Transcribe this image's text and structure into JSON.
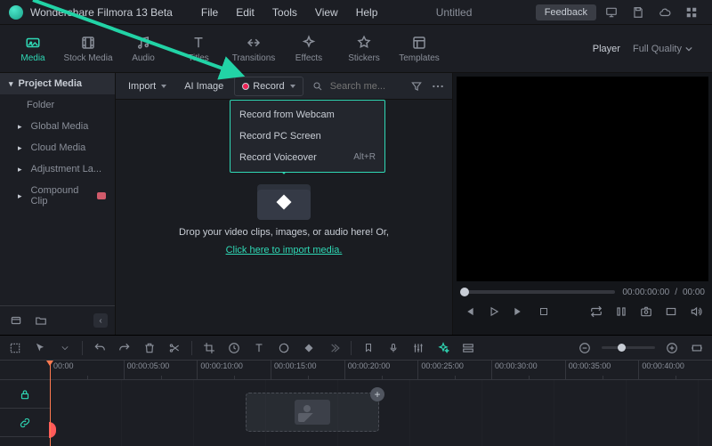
{
  "app": {
    "title": "Wondershare Filmora 13 Beta",
    "project": "Untitled",
    "feedback": "Feedback"
  },
  "menu": [
    "File",
    "Edit",
    "Tools",
    "View",
    "Help"
  ],
  "tabs": [
    {
      "label": "Media",
      "active": true
    },
    {
      "label": "Stock Media"
    },
    {
      "label": "Audio"
    },
    {
      "label": "Titles"
    },
    {
      "label": "Transitions"
    },
    {
      "label": "Effects"
    },
    {
      "label": "Stickers"
    },
    {
      "label": "Templates"
    }
  ],
  "player": {
    "label": "Player",
    "quality": "Full Quality"
  },
  "sidebar": {
    "header": "Project Media",
    "items": [
      {
        "label": "Folder",
        "indent": true
      },
      {
        "label": "Global Media",
        "caret": true
      },
      {
        "label": "Cloud Media",
        "caret": true
      },
      {
        "label": "Adjustment La...",
        "caret": true
      },
      {
        "label": "Compound Clip",
        "caret": true,
        "badge": "#d15b6b"
      }
    ]
  },
  "mediaToolbar": {
    "import": "Import",
    "aiimage": "AI Image",
    "record": "Record",
    "searchPlaceholder": "Search me..."
  },
  "recordMenu": [
    {
      "label": "Record from Webcam"
    },
    {
      "label": "Record PC Screen"
    },
    {
      "label": "Record Voiceover",
      "shortcut": "Alt+R"
    }
  ],
  "dropzone": {
    "line1": "Drop your video clips, images, or audio here! Or,",
    "line2": "Click here to import media."
  },
  "timecode": {
    "current": "00:00:00:00",
    "total": "00:00"
  },
  "ruler": [
    "00:00",
    "00:00:05:00",
    "00:00:10:00",
    "00:00:15:00",
    "00:00:20:00",
    "00:00:25:00",
    "00:00:30:00",
    "00:00:35:00",
    "00:00:40:00"
  ]
}
